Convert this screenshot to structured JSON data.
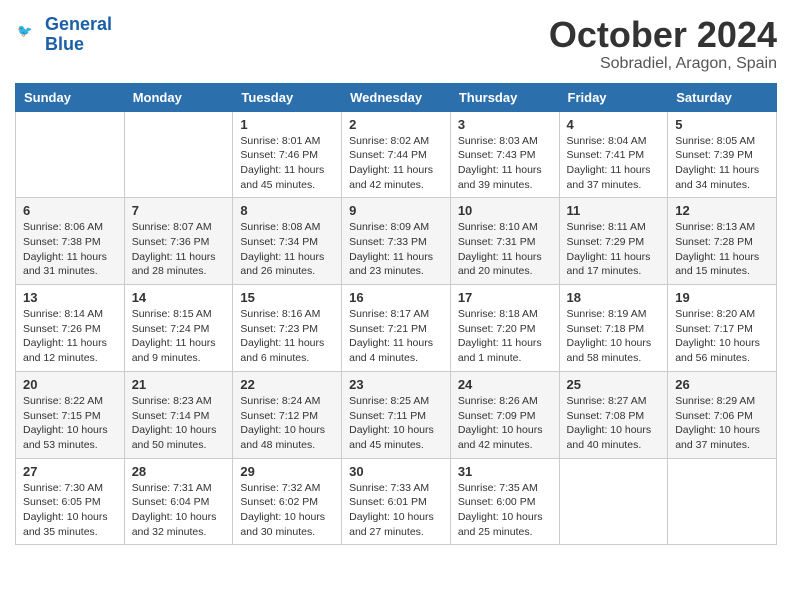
{
  "header": {
    "logo_line1": "General",
    "logo_line2": "Blue",
    "month": "October 2024",
    "location": "Sobradiel, Aragon, Spain"
  },
  "weekdays": [
    "Sunday",
    "Monday",
    "Tuesday",
    "Wednesday",
    "Thursday",
    "Friday",
    "Saturday"
  ],
  "weeks": [
    [
      {
        "day": "",
        "detail": ""
      },
      {
        "day": "",
        "detail": ""
      },
      {
        "day": "1",
        "detail": "Sunrise: 8:01 AM\nSunset: 7:46 PM\nDaylight: 11 hours and 45 minutes."
      },
      {
        "day": "2",
        "detail": "Sunrise: 8:02 AM\nSunset: 7:44 PM\nDaylight: 11 hours and 42 minutes."
      },
      {
        "day": "3",
        "detail": "Sunrise: 8:03 AM\nSunset: 7:43 PM\nDaylight: 11 hours and 39 minutes."
      },
      {
        "day": "4",
        "detail": "Sunrise: 8:04 AM\nSunset: 7:41 PM\nDaylight: 11 hours and 37 minutes."
      },
      {
        "day": "5",
        "detail": "Sunrise: 8:05 AM\nSunset: 7:39 PM\nDaylight: 11 hours and 34 minutes."
      }
    ],
    [
      {
        "day": "6",
        "detail": "Sunrise: 8:06 AM\nSunset: 7:38 PM\nDaylight: 11 hours and 31 minutes."
      },
      {
        "day": "7",
        "detail": "Sunrise: 8:07 AM\nSunset: 7:36 PM\nDaylight: 11 hours and 28 minutes."
      },
      {
        "day": "8",
        "detail": "Sunrise: 8:08 AM\nSunset: 7:34 PM\nDaylight: 11 hours and 26 minutes."
      },
      {
        "day": "9",
        "detail": "Sunrise: 8:09 AM\nSunset: 7:33 PM\nDaylight: 11 hours and 23 minutes."
      },
      {
        "day": "10",
        "detail": "Sunrise: 8:10 AM\nSunset: 7:31 PM\nDaylight: 11 hours and 20 minutes."
      },
      {
        "day": "11",
        "detail": "Sunrise: 8:11 AM\nSunset: 7:29 PM\nDaylight: 11 hours and 17 minutes."
      },
      {
        "day": "12",
        "detail": "Sunrise: 8:13 AM\nSunset: 7:28 PM\nDaylight: 11 hours and 15 minutes."
      }
    ],
    [
      {
        "day": "13",
        "detail": "Sunrise: 8:14 AM\nSunset: 7:26 PM\nDaylight: 11 hours and 12 minutes."
      },
      {
        "day": "14",
        "detail": "Sunrise: 8:15 AM\nSunset: 7:24 PM\nDaylight: 11 hours and 9 minutes."
      },
      {
        "day": "15",
        "detail": "Sunrise: 8:16 AM\nSunset: 7:23 PM\nDaylight: 11 hours and 6 minutes."
      },
      {
        "day": "16",
        "detail": "Sunrise: 8:17 AM\nSunset: 7:21 PM\nDaylight: 11 hours and 4 minutes."
      },
      {
        "day": "17",
        "detail": "Sunrise: 8:18 AM\nSunset: 7:20 PM\nDaylight: 11 hours and 1 minute."
      },
      {
        "day": "18",
        "detail": "Sunrise: 8:19 AM\nSunset: 7:18 PM\nDaylight: 10 hours and 58 minutes."
      },
      {
        "day": "19",
        "detail": "Sunrise: 8:20 AM\nSunset: 7:17 PM\nDaylight: 10 hours and 56 minutes."
      }
    ],
    [
      {
        "day": "20",
        "detail": "Sunrise: 8:22 AM\nSunset: 7:15 PM\nDaylight: 10 hours and 53 minutes."
      },
      {
        "day": "21",
        "detail": "Sunrise: 8:23 AM\nSunset: 7:14 PM\nDaylight: 10 hours and 50 minutes."
      },
      {
        "day": "22",
        "detail": "Sunrise: 8:24 AM\nSunset: 7:12 PM\nDaylight: 10 hours and 48 minutes."
      },
      {
        "day": "23",
        "detail": "Sunrise: 8:25 AM\nSunset: 7:11 PM\nDaylight: 10 hours and 45 minutes."
      },
      {
        "day": "24",
        "detail": "Sunrise: 8:26 AM\nSunset: 7:09 PM\nDaylight: 10 hours and 42 minutes."
      },
      {
        "day": "25",
        "detail": "Sunrise: 8:27 AM\nSunset: 7:08 PM\nDaylight: 10 hours and 40 minutes."
      },
      {
        "day": "26",
        "detail": "Sunrise: 8:29 AM\nSunset: 7:06 PM\nDaylight: 10 hours and 37 minutes."
      }
    ],
    [
      {
        "day": "27",
        "detail": "Sunrise: 7:30 AM\nSunset: 6:05 PM\nDaylight: 10 hours and 35 minutes."
      },
      {
        "day": "28",
        "detail": "Sunrise: 7:31 AM\nSunset: 6:04 PM\nDaylight: 10 hours and 32 minutes."
      },
      {
        "day": "29",
        "detail": "Sunrise: 7:32 AM\nSunset: 6:02 PM\nDaylight: 10 hours and 30 minutes."
      },
      {
        "day": "30",
        "detail": "Sunrise: 7:33 AM\nSunset: 6:01 PM\nDaylight: 10 hours and 27 minutes."
      },
      {
        "day": "31",
        "detail": "Sunrise: 7:35 AM\nSunset: 6:00 PM\nDaylight: 10 hours and 25 minutes."
      },
      {
        "day": "",
        "detail": ""
      },
      {
        "day": "",
        "detail": ""
      }
    ]
  ]
}
